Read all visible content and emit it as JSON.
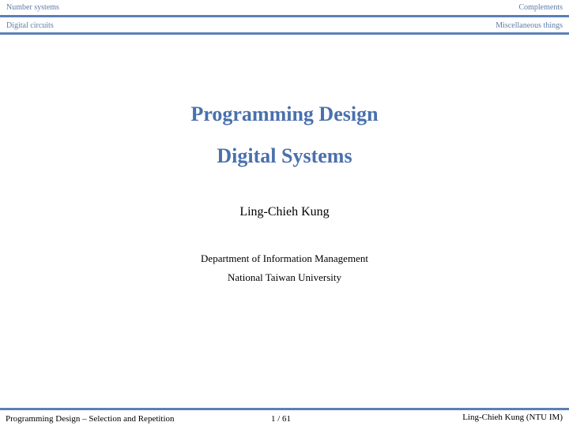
{
  "header": {
    "sections_left": "Number systems",
    "sections_right": "Complements",
    "subsections_left": "Digital circuits",
    "subsections_right": "Miscellaneous things"
  },
  "title_slide": {
    "title_line_1": "Programming Design",
    "title_line_2": "Digital Systems",
    "author": "Ling-Chieh Kung",
    "department": "Department of Information Management",
    "university": "National Taiwan University"
  },
  "footer": {
    "left": "Programming Design – Selection and Repetition",
    "page": "1 / 61",
    "right": "Ling-Chieh Kung (NTU IM)"
  },
  "colors": {
    "accent": "#4a70ad",
    "rule": "#5b7fb5",
    "nav_text": "#5f7ca8"
  }
}
